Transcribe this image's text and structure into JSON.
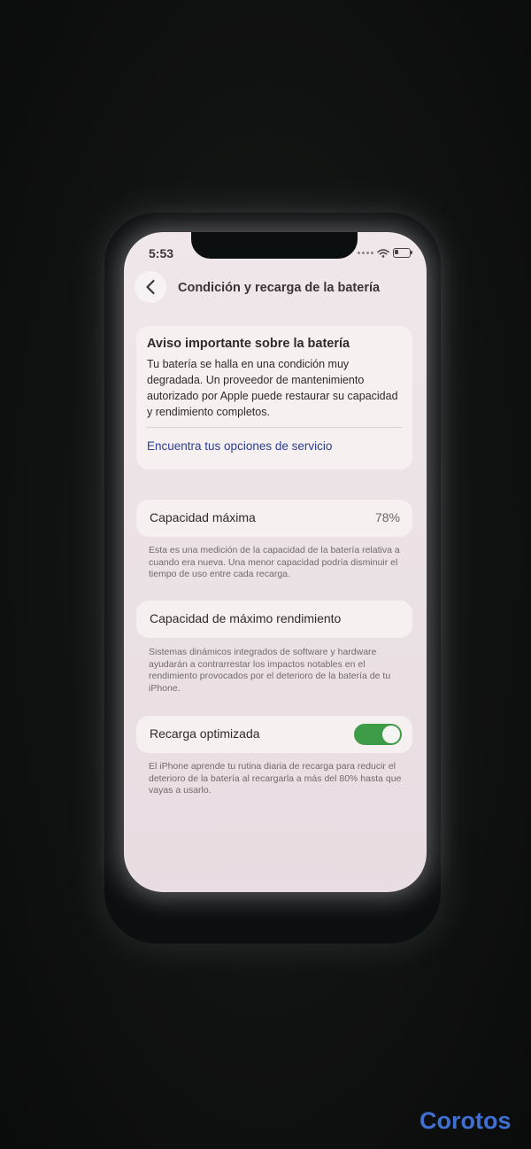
{
  "status_bar": {
    "time": "5:53"
  },
  "header": {
    "title": "Condición y recarga de la batería"
  },
  "notice": {
    "title": "Aviso importante sobre la batería",
    "body": "Tu batería se halla en una condición muy degradada. Un proveedor de mantenimiento autorizado por Apple puede restaurar su capacidad y rendimiento completos.",
    "link": "Encuentra tus opciones de servicio"
  },
  "max_capacity": {
    "label": "Capacidad máxima",
    "value": "78%",
    "footnote": "Esta es una medición de la capacidad de la batería relativa a cuando era nueva. Una menor capacidad podría disminuir el tiempo de uso entre cada recarga."
  },
  "peak_performance": {
    "label": "Capacidad de máximo rendimiento",
    "footnote": "Sistemas dinámicos integrados de software y hardware ayudarán a contrarrestar los impactos notables en el rendimiento provocados por el deterioro de la batería de tu iPhone."
  },
  "optimized_charging": {
    "label": "Recarga optimizada",
    "enabled": true,
    "footnote": "El iPhone aprende tu rutina diaria de recarga para reducir el deterioro de la batería al recargarla a más del 80% hasta que vayas a usarlo."
  },
  "watermark": {
    "text": "Corotos"
  },
  "colors": {
    "link": "#2c3f95",
    "toggle_on": "#3e9b47",
    "watermark": "#3f6fd1"
  }
}
